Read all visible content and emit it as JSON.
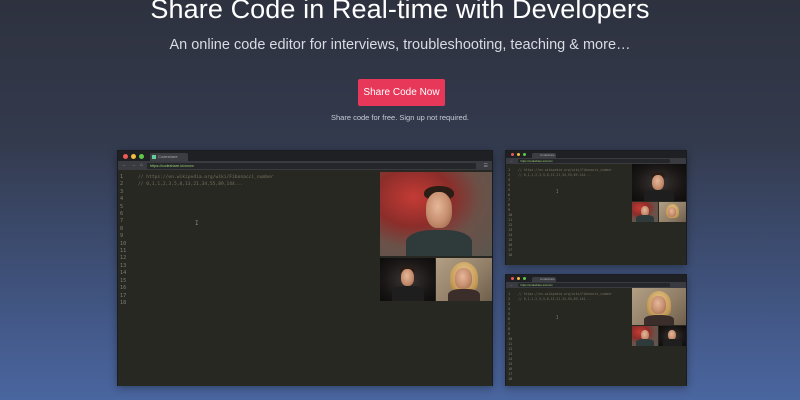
{
  "hero": {
    "title": "Share Code in Real-time with Developers",
    "subtitle": "An online code editor for interviews, troubleshooting, teaching & more…",
    "cta_label": "Share Code Now",
    "cta_note": "Share code for free. Sign up not required."
  },
  "main_window": {
    "tab_label": "Codeshare",
    "url": "https://codeshare.io/xxxxx",
    "line_numbers": [
      "1",
      "2",
      "3",
      "4",
      "5",
      "6",
      "7",
      "8",
      "9",
      "10",
      "11",
      "12",
      "13",
      "14",
      "15",
      "16",
      "17",
      "18"
    ],
    "code_lines": [
      "// https://en.wikipedia.org/wiki/Fibonacci_number",
      "// 0,1,1,2,3,5,8,13,21,34,55,89,144..."
    ]
  },
  "small_window_top": {
    "tab_label": "Codeshare",
    "url": "https://codeshare.io/xxxxx",
    "line_numbers": [
      "1",
      "2",
      "3",
      "4",
      "5",
      "6",
      "7",
      "8",
      "9",
      "10",
      "11",
      "12",
      "13",
      "14",
      "15",
      "16",
      "17",
      "18"
    ],
    "code_lines": [
      "// https://en.wikipedia.org/wiki/Fibonacci_number",
      "// 0,1,1,2,3,5,8,13,21,34,55,89,144..."
    ]
  },
  "small_window_bottom": {
    "tab_label": "Codeshare",
    "url": "https://codeshare.io/xxxxx",
    "line_numbers": [
      "1",
      "2",
      "3",
      "4",
      "5",
      "6",
      "7",
      "8",
      "9",
      "10",
      "11",
      "12",
      "13",
      "14",
      "15",
      "16",
      "17",
      "18"
    ],
    "code_lines": [
      "// https://en.wikipedia.org/wiki/Fibonacci_number",
      "// 0,1,1,2,3,5,8,13,21,34,55,89,144..."
    ]
  },
  "icons": {
    "back": "back-arrow-icon",
    "forward": "forward-arrow-icon",
    "home": "home-icon",
    "menu": "hamburger-menu-icon",
    "cursor": "text-cursor-icon"
  },
  "colors": {
    "cta": "#e8385a",
    "editor_bg": "#272822",
    "bg_top": "#2e323f",
    "bg_bottom": "#4a66a0"
  }
}
